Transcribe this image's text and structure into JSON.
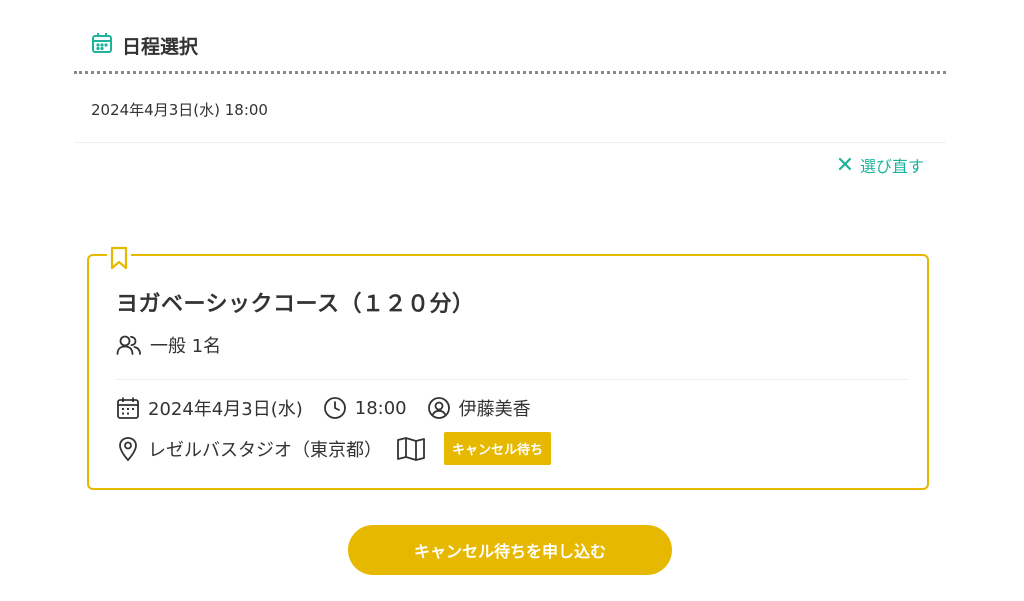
{
  "schedule_section": {
    "title": "日程選択",
    "selected_datetime": "2024年4月3日(水) 18:00",
    "reselect_label": "選び直す"
  },
  "course_card": {
    "title": "ヨガベーシックコース（１２０分）",
    "participants": "一般 1名",
    "date": "2024年4月3日(水)",
    "time": "18:00",
    "instructor": "伊藤美香",
    "studio": "レゼルバスタジオ（東京都）",
    "badge": "キャンセル待ち"
  },
  "apply_button_label": "キャンセル待ちを申し込む",
  "colors": {
    "accent": "#e6b800",
    "teal": "#1db39c",
    "text": "#333333"
  },
  "icons": {
    "header": "calendar-icon",
    "reselect": "close-icon",
    "card": "bookmark-icon",
    "participants": "users-icon",
    "date": "calendar-icon",
    "time": "clock-icon",
    "instructor": "user-circle-icon",
    "studio": "map-pin-icon",
    "map": "map-icon"
  }
}
